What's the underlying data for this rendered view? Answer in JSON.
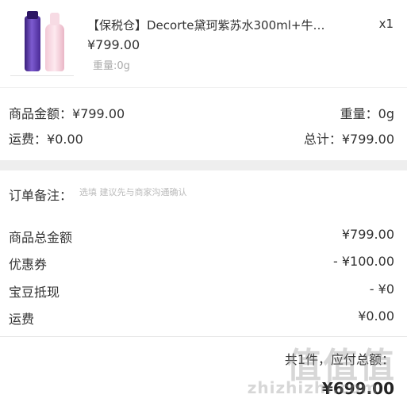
{
  "product": {
    "title": "【保税仓】Decorte黛珂紫苏水300ml+牛…",
    "quantity": "x1",
    "price": "¥799.00",
    "weight": "重量:0g"
  },
  "summary": {
    "goods_amount_label": "商品金额：",
    "goods_amount_value": "¥799.00",
    "weight_label": "重量：",
    "weight_value": "0g",
    "shipping_label": "运费：",
    "shipping_value": "¥0.00",
    "total_label": "总计：",
    "total_value": "¥799.00"
  },
  "remark": {
    "label": "订单备注：",
    "placeholder": "选填 建议先与商家沟通确认"
  },
  "breakdown": [
    {
      "label": "商品总金额",
      "value": "¥799.00"
    },
    {
      "label": "优惠券",
      "value": "- ¥100.00"
    },
    {
      "label": "宝豆抵现",
      "value": "- ¥0"
    },
    {
      "label": "运费",
      "value": "¥0.00"
    }
  ],
  "footer": {
    "count_text": "共1件，应付总额：",
    "total": "¥699.00"
  },
  "watermark": {
    "glyphs": "值值值",
    "text": "zhizhizhi.com"
  }
}
